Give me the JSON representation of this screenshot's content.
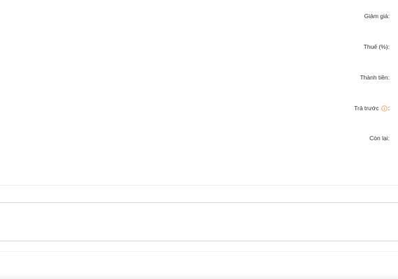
{
  "summary": {
    "discount_label": "Giảm giá:",
    "tax_label": "Thuế (%):",
    "total_label": "Thành tiền:",
    "prepaid_label": "Trả trước",
    "prepaid_colon": ":",
    "prepaid_info_icon": "info-circle-icon",
    "remaining_label": "Còn lại:"
  },
  "colors": {
    "info_icon": "#f5a25d",
    "text": "#333333",
    "divider": "#d6d6d6"
  }
}
